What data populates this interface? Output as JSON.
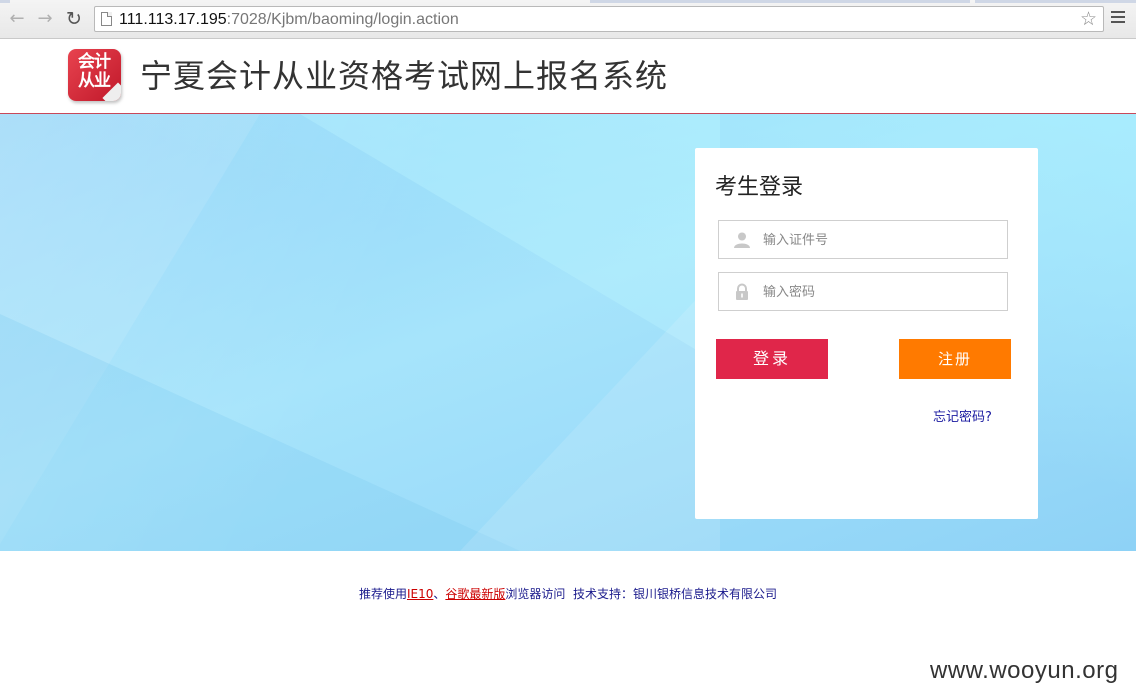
{
  "browser": {
    "url_host": "111.113.17.195",
    "url_path": ":7028/Kjbm/baoming/login.action",
    "back_icon": "back-arrow-icon",
    "forward_icon": "forward-arrow-icon",
    "reload_icon": "reload-icon",
    "bookmark_icon": "star-icon",
    "menu_icon": "hamburger-menu-icon"
  },
  "header": {
    "logo_text": "会计从业",
    "title": "宁夏会计从业资格考试网上报名系统"
  },
  "login": {
    "title": "考生登录",
    "id_placeholder": "输入证件号",
    "password_placeholder": "输入密码",
    "login_label": "登录",
    "register_label": "注册",
    "forgot_label": "忘记密码?"
  },
  "footer": {
    "prefix": "推荐使用",
    "ie_link": "IE10",
    "sep": "、",
    "chrome_link": "谷歌最新版",
    "suffix": "浏览器访问  技术支持：银川银桥信息技术有限公司"
  },
  "watermark": "www.wooyun.org",
  "colors": {
    "login_button": "#e0264a",
    "register_button": "#ff7a00",
    "banner": "#a6e4fb",
    "header_rule": "#c8485a"
  }
}
